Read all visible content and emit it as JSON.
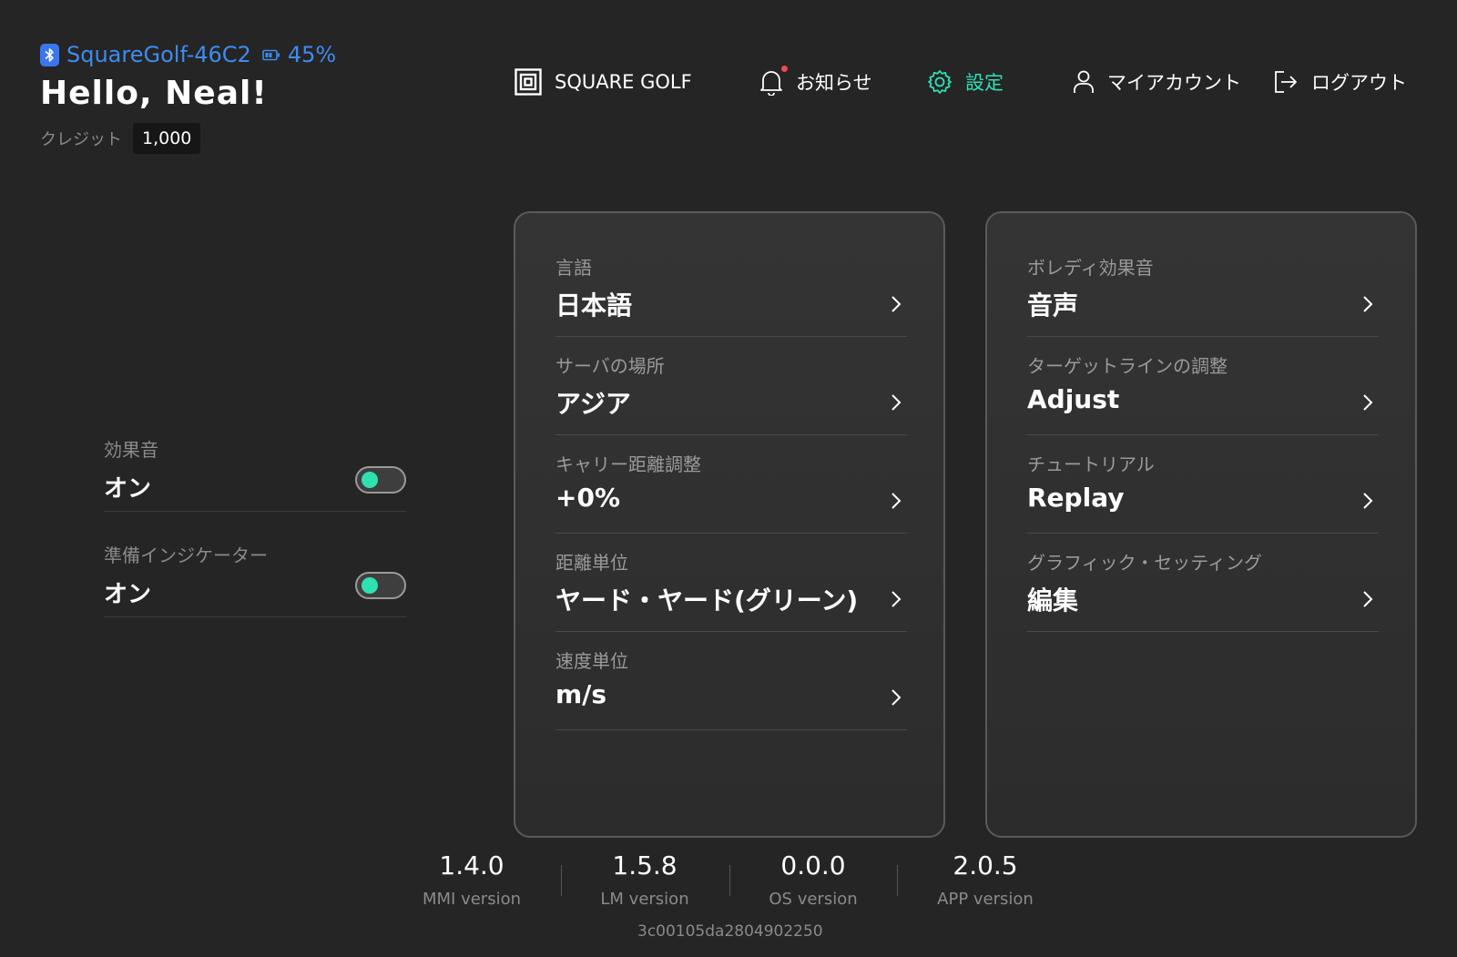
{
  "header": {
    "device_name": "SquareGolf-46C2",
    "battery_percent": "45%",
    "greeting": "Hello, Neal!",
    "credit_label": "クレジット",
    "credit_value": "1,000"
  },
  "nav": {
    "brand": "SQUARE GOLF",
    "notifications": "お知らせ",
    "settings": "設定",
    "my_account": "マイアカウント",
    "logout": "ログアウト",
    "active_item": "settings"
  },
  "toggles": [
    {
      "label": "効果音",
      "value": "オン",
      "enabled": true
    },
    {
      "label": "準備インジケーター",
      "value": "オン",
      "enabled": true
    }
  ],
  "panel_left": [
    {
      "label": "言語",
      "value": "日本語"
    },
    {
      "label": "サーバの場所",
      "value": "アジア"
    },
    {
      "label": "キャリー距離調整",
      "value": "+0%"
    },
    {
      "label": "距離単位",
      "value": "ヤード・ヤード(グリーン)"
    },
    {
      "label": "速度単位",
      "value": "m/s"
    }
  ],
  "panel_right": [
    {
      "label": "ボレディ効果音",
      "value": "音声"
    },
    {
      "label": "ターゲットラインの調整",
      "value": "Adjust"
    },
    {
      "label": "チュートリアル",
      "value": "Replay"
    },
    {
      "label": "グラフィック・セッティング",
      "value": "編集"
    }
  ],
  "versions": [
    {
      "number": "1.4.0",
      "caption": "MMI version"
    },
    {
      "number": "1.5.8",
      "caption": "LM version"
    },
    {
      "number": "0.0.0",
      "caption": "OS version"
    },
    {
      "number": "2.0.5",
      "caption": "APP version"
    }
  ],
  "build_hash": "3c00105da2804902250",
  "colors": {
    "background": "#252525",
    "accent": "#30e0b5",
    "bluetooth": "#3e8bf0",
    "notification_dot": "#f0494f"
  },
  "icons": {
    "bluetooth": "bluetooth-icon",
    "battery": "battery-icon",
    "brand": "square-golf-logo-icon",
    "notifications": "bell-icon",
    "settings": "gear-icon",
    "account": "person-icon",
    "logout": "logout-icon",
    "chevron": "chevron-right-icon"
  }
}
